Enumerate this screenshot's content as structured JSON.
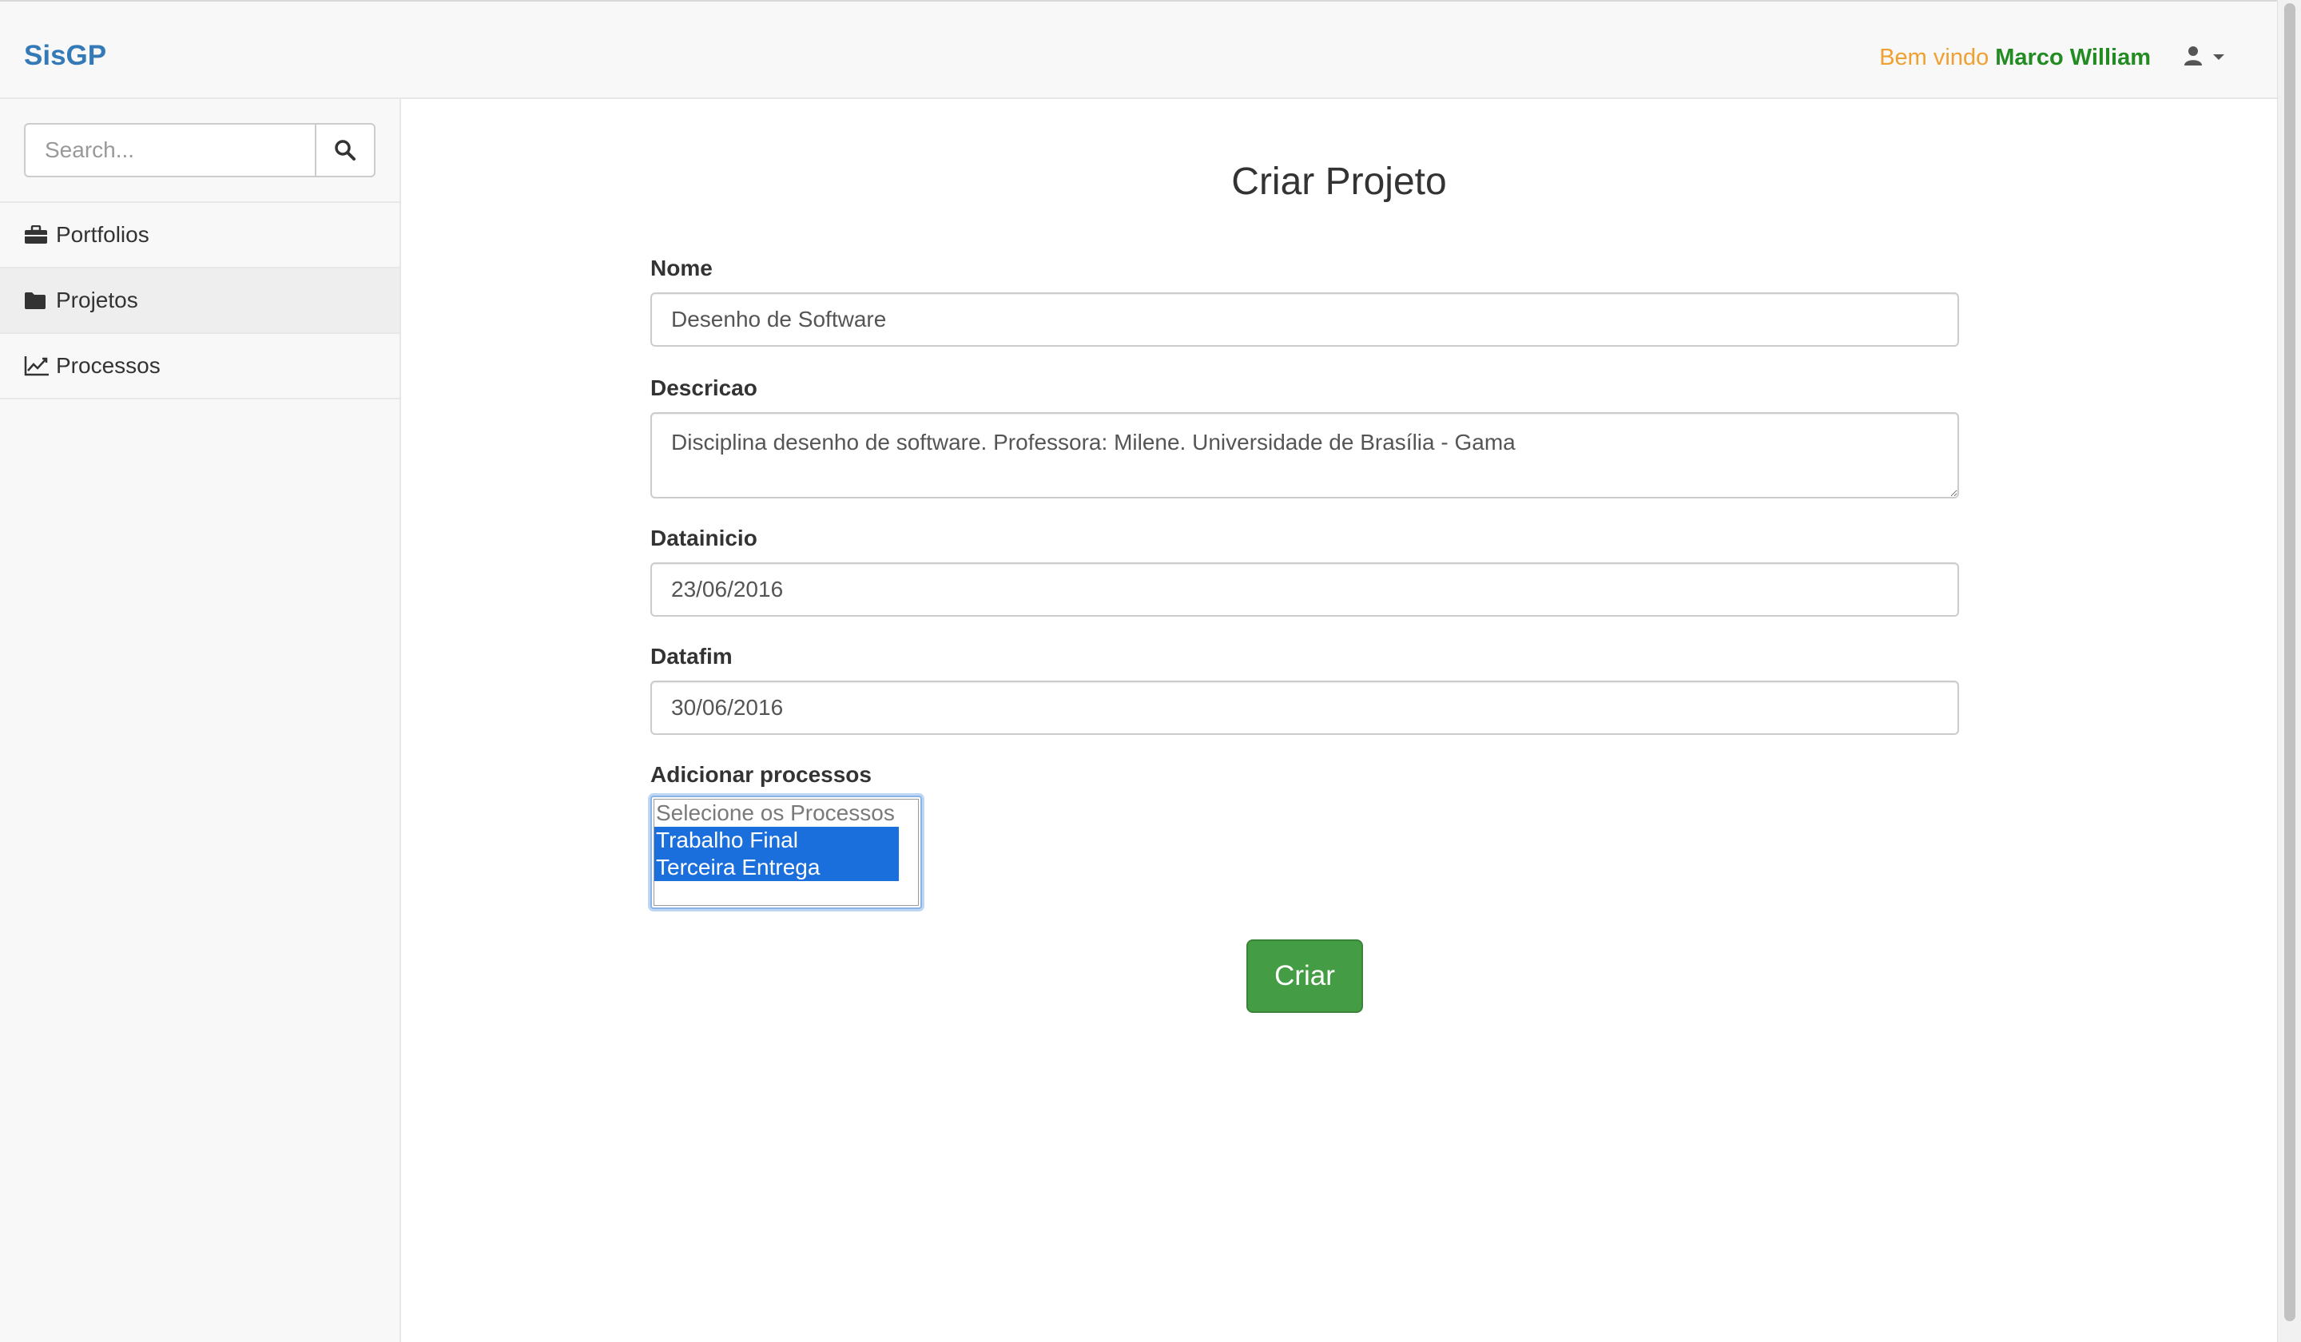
{
  "app": {
    "brand": "SisGP"
  },
  "header": {
    "welcome_prefix": "Bem vindo",
    "user_name": "Marco William",
    "user_icon": "user-icon",
    "caret_icon": "caret-down-icon"
  },
  "sidebar": {
    "search": {
      "placeholder": "Search...",
      "value": "",
      "icon": "search-icon"
    },
    "items": [
      {
        "label": "Portfolios",
        "icon": "briefcase-icon",
        "active": false
      },
      {
        "label": "Projetos",
        "icon": "folder-icon",
        "active": true
      },
      {
        "label": "Processos",
        "icon": "line-chart-icon",
        "active": false
      }
    ]
  },
  "form": {
    "title": "Criar Projeto",
    "fields": {
      "nome": {
        "label": "Nome",
        "value": "Desenho de Software"
      },
      "descricao": {
        "label": "Descricao",
        "value": "Disciplina desenho de software. Professora: Milene. Universidade de Brasília - Gama"
      },
      "datainicio": {
        "label": "Datainicio",
        "value": "23/06/2016"
      },
      "datafim": {
        "label": "Datafim",
        "value": "30/06/2016"
      }
    },
    "processos": {
      "label": "Adicionar processos",
      "placeholder": "Selecione os Processos",
      "options": [
        {
          "label": "Trabalho Final",
          "selected": true
        },
        {
          "label": "Terceira Entrega",
          "selected": true
        }
      ]
    },
    "submit_label": "Criar"
  },
  "colors": {
    "brand": "#337ab7",
    "welcome_prefix": "#f0a030",
    "user_name": "#228b22",
    "submit": "#449d44",
    "selected_option": "#1a6fdc"
  }
}
